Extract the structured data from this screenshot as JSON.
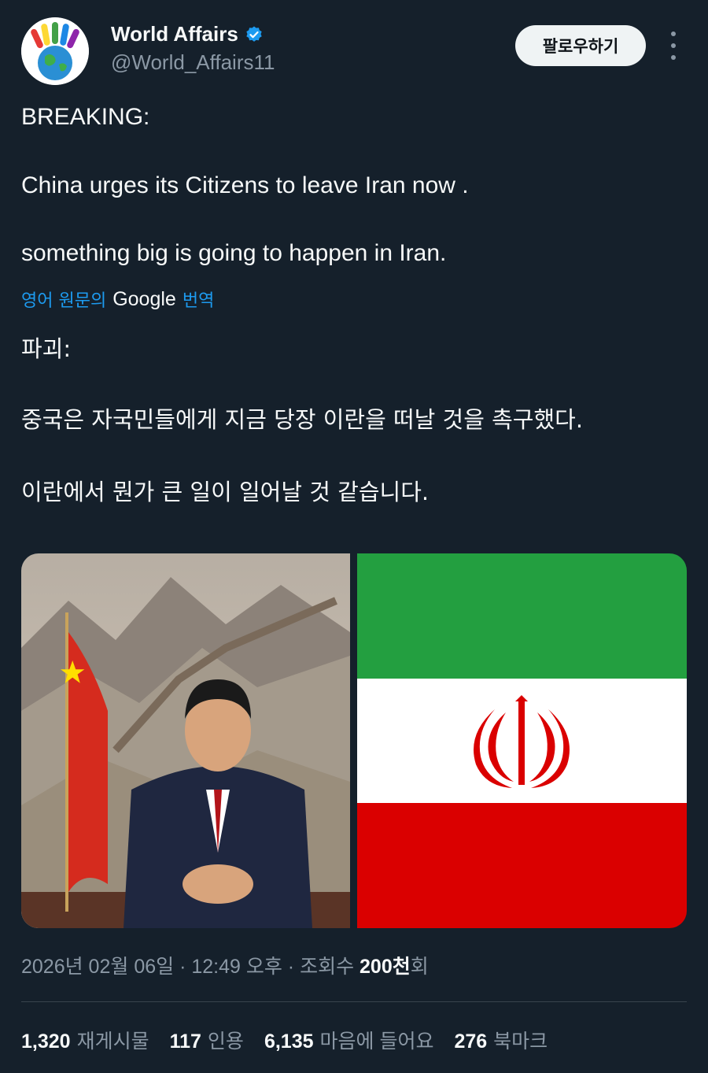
{
  "author": {
    "name": "World Affairs",
    "handle": "@World_Affairs11",
    "verified_color": "#1d9bf0"
  },
  "follow_label": "팔로우하기",
  "tweet": {
    "line1": "BREAKING:",
    "line2": "China urges its Citizens to leave Iran now .",
    "line3": "something big is going to happen in Iran."
  },
  "translation": {
    "prefix": "영어 원문의",
    "brand": "Google",
    "suffix": "번역",
    "line1": "파괴:",
    "line2": "중국은 자국민들에게 지금 당장 이란을 떠날 것을 촉구했다.",
    "line3": "이란에서 뭔가 큰 일이 일어날 것 같습니다."
  },
  "meta": {
    "date_time": "2026년 02월 06일 · 12:49 오후 · 조회수 ",
    "views": "200천",
    "views_suffix": "회"
  },
  "stats": [
    {
      "count": "1,320",
      "label": "재게시물"
    },
    {
      "count": "117",
      "label": "인용"
    },
    {
      "count": "6,135",
      "label": "마음에 들어요"
    },
    {
      "count": "276",
      "label": "북마크"
    }
  ],
  "colors": {
    "background": "#15202b",
    "link": "#1d9bf0",
    "muted": "#8b98a5",
    "iran_green": "#239f40",
    "iran_red": "#da0000"
  },
  "icons": [
    "verified-badge-icon",
    "more-options-icon"
  ]
}
